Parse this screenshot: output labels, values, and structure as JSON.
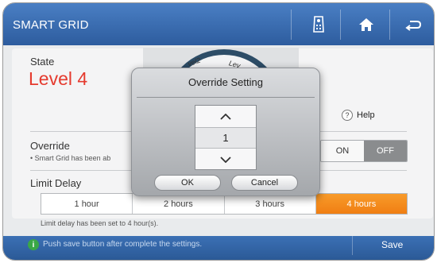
{
  "header": {
    "title": "SMART GRID"
  },
  "state": {
    "label": "State",
    "value": "Level 4",
    "value_color": "#e53a2e"
  },
  "gauge": {
    "label_left": "vel2",
    "label_right": "Lev"
  },
  "help": {
    "label": "Help",
    "icon_glyph": "?"
  },
  "override": {
    "label": "Override",
    "note": "• Smart Grid has been ab",
    "options": [
      "ON",
      "OFF"
    ],
    "selected": "OFF"
  },
  "limit_delay": {
    "label": "Limit Delay",
    "options": [
      "1 hour",
      "2 hours",
      "3 hours",
      "4 hours"
    ],
    "selected": "4 hours",
    "note": "Limit delay has been set to 4 hour(s)."
  },
  "footer": {
    "info_glyph": "i",
    "message": "Push save button after complete the settings.",
    "save_label": "Save"
  },
  "modal": {
    "title": "Override Setting",
    "value": "1",
    "ok_label": "OK",
    "cancel_label": "Cancel"
  },
  "colors": {
    "header": "#3a6db0",
    "accent_orange": "#f28a1c",
    "footer": "#2f609f"
  }
}
